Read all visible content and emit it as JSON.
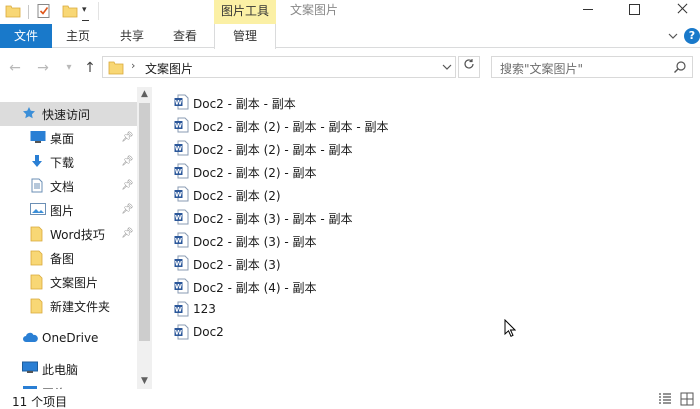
{
  "window": {
    "title": "文案图片",
    "context_tab_group": "图片工具"
  },
  "ribbon": {
    "tabs": [
      {
        "label": "文件"
      },
      {
        "label": "主页"
      },
      {
        "label": "共享"
      },
      {
        "label": "查看"
      },
      {
        "label": "管理"
      }
    ],
    "help_label": "?"
  },
  "address_bar": {
    "path": "文案图片",
    "search_placeholder": "搜索\"文案图片\""
  },
  "nav_pane": {
    "items": [
      {
        "label": "快速访问",
        "icon": "star-icon",
        "pinned": false
      },
      {
        "label": "桌面",
        "icon": "desktop-icon",
        "pinned": true
      },
      {
        "label": "下载",
        "icon": "download-arrow-icon",
        "pinned": true
      },
      {
        "label": "文档",
        "icon": "document-icon",
        "pinned": true
      },
      {
        "label": "图片",
        "icon": "picture-icon",
        "pinned": true
      },
      {
        "label": "Word技巧",
        "icon": "folder-icon",
        "pinned": true
      },
      {
        "label": "备图",
        "icon": "folder-icon",
        "pinned": false
      },
      {
        "label": "文案图片",
        "icon": "folder-icon",
        "pinned": false
      },
      {
        "label": "新建文件夹",
        "icon": "folder-icon",
        "pinned": false
      },
      {
        "label": "OneDrive",
        "icon": "cloud-icon",
        "pinned": false
      },
      {
        "label": "此电脑",
        "icon": "computer-icon",
        "pinned": false
      },
      {
        "label": "网络",
        "icon": "network-icon",
        "pinned": false
      }
    ]
  },
  "files": [
    {
      "name": "Doc2 - 副本 - 副本"
    },
    {
      "name": "Doc2 - 副本 (2) - 副本 - 副本 - 副本"
    },
    {
      "name": "Doc2 - 副本 (2) - 副本 - 副本"
    },
    {
      "name": "Doc2 - 副本 (2) - 副本"
    },
    {
      "name": "Doc2 - 副本 (2)"
    },
    {
      "name": "Doc2 - 副本 (3) - 副本 - 副本"
    },
    {
      "name": "Doc2 - 副本 (3) - 副本"
    },
    {
      "name": "Doc2 - 副本 (3)"
    },
    {
      "name": "Doc2 - 副本 (4) - 副本"
    },
    {
      "name": "123"
    },
    {
      "name": "Doc2"
    }
  ],
  "status": {
    "item_count": "11 个项目"
  },
  "colors": {
    "accent": "#1979ca",
    "context_tab": "#fbf0a5",
    "folder": "#f8d775",
    "selected_nav": "#dcdcdc"
  }
}
